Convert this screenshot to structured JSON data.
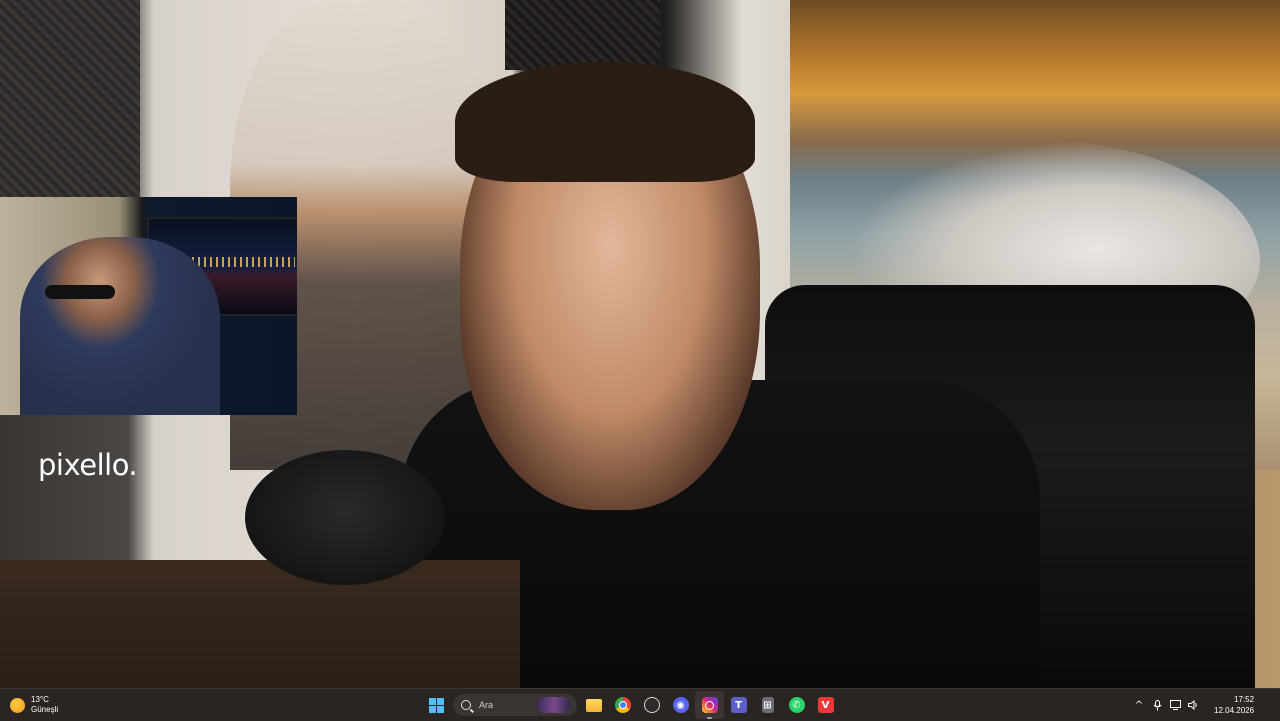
{
  "desktop": {
    "watermark": "pixello."
  },
  "taskbar": {
    "weather": {
      "temp": "13°C",
      "condition": "Güneşli",
      "icon": "sun-icon"
    },
    "search": {
      "label": "Ara",
      "icon": "search-icon"
    },
    "start_icon": "windows-start-icon",
    "pinned_apps": [
      {
        "name": "file-explorer",
        "icon": "folder-icon",
        "color": "#f3c34a"
      },
      {
        "name": "chrome",
        "icon": "chrome-icon",
        "color": "#ea4335"
      },
      {
        "name": "obs-studio",
        "icon": "obs-icon",
        "color": "#3a3a3a"
      },
      {
        "name": "discord",
        "icon": "discord-icon",
        "color": "#5865f2"
      },
      {
        "name": "instagram",
        "icon": "instagram-icon",
        "color": "#d62976",
        "active": true
      },
      {
        "name": "teams",
        "icon": "teams-icon",
        "color": "#5b5fc7"
      },
      {
        "name": "calculator",
        "icon": "calculator-icon",
        "color": "#6a6f77"
      },
      {
        "name": "whatsapp",
        "icon": "whatsapp-icon",
        "color": "#25d366"
      },
      {
        "name": "vivaldi",
        "icon": "vivaldi-icon",
        "color": "#ef3939"
      }
    ],
    "tray": {
      "chevron": "^",
      "icons": [
        "microphone-icon",
        "display-icon",
        "speaker-icon"
      ],
      "time": "17:52",
      "date": "12.04.2026"
    }
  },
  "colors": {
    "taskbar_bg": "#2a2523",
    "accent": "#4cc2ff"
  }
}
